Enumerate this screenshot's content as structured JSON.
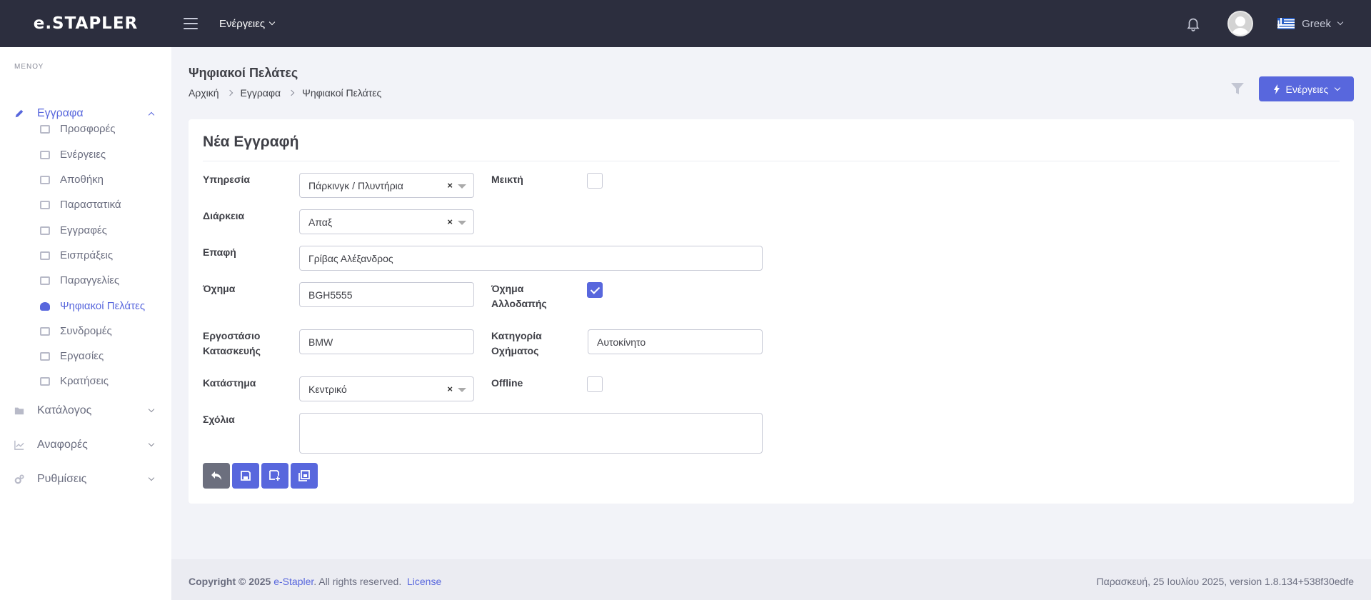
{
  "brand": {
    "logo": "e.STAPLER"
  },
  "topbar": {
    "actions_label": "Ενέργειες",
    "language": "Greek"
  },
  "sidebar": {
    "caption": "ΜΕΝΟΥ",
    "groups": [
      {
        "label": "Εγγραφα",
        "icon": "pencil-icon",
        "expanded": true
      },
      {
        "label": "Κατάλογος",
        "icon": "folder-icon",
        "expanded": false
      },
      {
        "label": "Αναφορές",
        "icon": "chart-line-icon",
        "expanded": false
      },
      {
        "label": "Ρυθμίσεις",
        "icon": "gears-icon",
        "expanded": false
      }
    ],
    "items": [
      {
        "label": "Προσφορές",
        "icon": "book-icon"
      },
      {
        "label": "Ενέργειες",
        "icon": "id-card-icon"
      },
      {
        "label": "Αποθήκη",
        "icon": "boxes-icon"
      },
      {
        "label": "Παραστατικά",
        "icon": "book-icon"
      },
      {
        "label": "Εγγραφές",
        "icon": "list-icon"
      },
      {
        "label": "Εισπράξεις",
        "icon": "money-icon"
      },
      {
        "label": "Παραγγελίες",
        "icon": "basket-icon"
      },
      {
        "label": "Ψηφιακοί Πελάτες",
        "icon": "users-icon",
        "active": true
      },
      {
        "label": "Συνδρομές",
        "icon": "list-alt-icon"
      },
      {
        "label": "Εργασίες",
        "icon": "tags-icon"
      },
      {
        "label": "Κρατήσεις",
        "icon": "badge-icon"
      }
    ]
  },
  "page": {
    "title": "Ψηφιακοί Πελάτες",
    "breadcrumb": [
      "Αρχική",
      "Εγγραφα",
      "Ψηφιακοί Πελάτες"
    ],
    "actions_button": "Ενέργειες"
  },
  "form": {
    "title": "Νέα Εγγραφή",
    "service": {
      "label": "Υπηρεσία",
      "value": "Πάρκινγκ / Πλυντήρια"
    },
    "mixed": {
      "label": "Μεικτή",
      "checked": false
    },
    "duration": {
      "label": "Διάρκεια",
      "value": "Απαξ"
    },
    "contact": {
      "label": "Επαφή",
      "value": "Γρίβας Αλέξανδρος"
    },
    "vehicle": {
      "label": "Όχημα",
      "value": "BGH5555"
    },
    "foreign_vehicle": {
      "label_line1": "Όχημα",
      "label_line2": "Αλλοδαπής",
      "checked": true
    },
    "manufacturer": {
      "label_line1": "Εργοστάσιο",
      "label_line2": "Κατασκευής",
      "value": "BMW"
    },
    "vehicle_category": {
      "label_line1": "Κατηγορία",
      "label_line2": "Οχήματος",
      "value": "Αυτοκίνητο"
    },
    "store": {
      "label": "Κατάστημα",
      "value": "Κεντρικό"
    },
    "offline": {
      "label": "Offline",
      "checked": false
    },
    "comments": {
      "label": "Σχόλια",
      "value": ""
    },
    "clear_symbol": "×"
  },
  "footer": {
    "copyright_prefix": "Copyright © 2025",
    "company": "e-Stapler",
    "rights": ". All rights reserved.",
    "license": "License",
    "right_text": "Παρασκευή, 25 Ιουλίου 2025, version 1.8.134+538f30edfe"
  },
  "colors": {
    "topbar": "#2c2e3e",
    "accent": "#5867dd",
    "back_button": "#6c6f7e",
    "background": "#f2f3f8"
  }
}
